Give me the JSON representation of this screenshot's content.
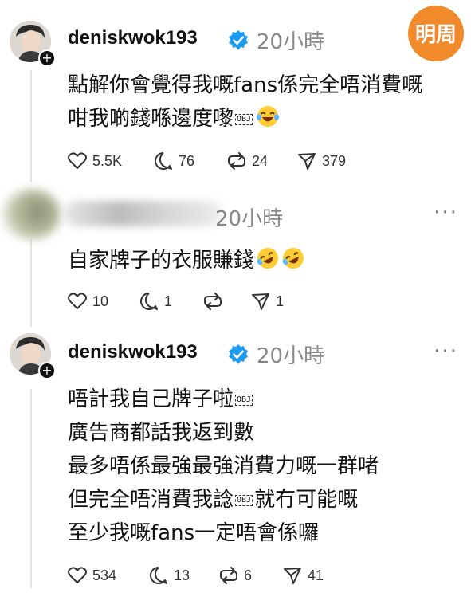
{
  "app": {
    "brand_logo_text": "明周"
  },
  "posts": [
    {
      "username": "deniskwok193",
      "time": "20小時",
      "lines": [
        "點解你會覺得我嘅fans係完全唔消費嘅",
        "咁我啲錢喺邊度嚟"
      ],
      "objmark": "OBJ",
      "stats": {
        "likes": "5.5K",
        "replies": "76",
        "reposts": "24",
        "shares": "379"
      }
    },
    {
      "username": "",
      "time": "20小時",
      "lines": [
        "自家牌子的衣服賺錢"
      ],
      "stats": {
        "likes": "10",
        "replies": "1",
        "reposts": "",
        "shares": "1"
      }
    },
    {
      "username": "deniskwok193",
      "time": "20小時",
      "lines": [
        "唔計我自己牌子啦",
        "廣告商都話我返到數",
        "最多唔係最強最強消費力嘅一群啫",
        "但完全唔消費我諗",
        "就冇可能嘅",
        "至少我嘅fans一定唔會係囉"
      ],
      "objmark": "OBJ",
      "stats": {
        "likes": "534",
        "replies": "13",
        "reposts": "6",
        "shares": "41"
      }
    }
  ],
  "icons": [
    "plus-icon",
    "verified-icon",
    "heart-icon",
    "reply-icon",
    "repost-icon",
    "share-icon",
    "more-icon",
    "laughing-emoji-icon",
    "rofl-emoji-icon"
  ],
  "colors": {
    "verified": "#1d9bf0",
    "logo": "#f08a2a",
    "muted": "#888888"
  }
}
